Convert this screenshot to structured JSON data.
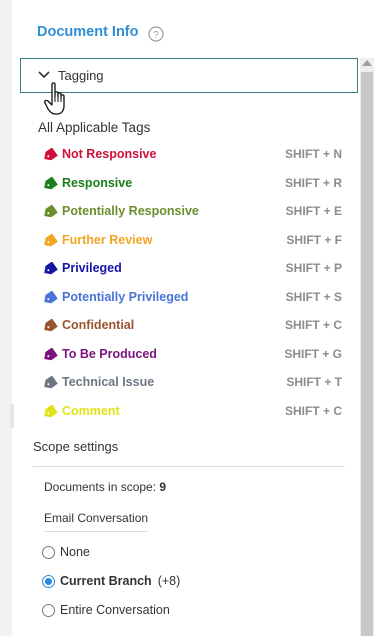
{
  "panel": {
    "title": "Document Info"
  },
  "tagging": {
    "label": "Tagging",
    "section_title": "All Applicable Tags",
    "tags": [
      {
        "name": "Not Responsive",
        "shortcut": "SHIFT + N",
        "color": "#d0103a"
      },
      {
        "name": "Responsive",
        "shortcut": "SHIFT + R",
        "color": "#1a7f1a"
      },
      {
        "name": "Potentially Responsive",
        "shortcut": "SHIFT + E",
        "color": "#6b8f2c"
      },
      {
        "name": "Further Review",
        "shortcut": "SHIFT + F",
        "color": "#f2a423"
      },
      {
        "name": "Privileged",
        "shortcut": "SHIFT + P",
        "color": "#1515a8"
      },
      {
        "name": "Potentially Privileged",
        "shortcut": "SHIFT + S",
        "color": "#4a74d8"
      },
      {
        "name": "Confidential",
        "shortcut": "SHIFT + C",
        "color": "#9a5432"
      },
      {
        "name": "To Be Produced",
        "shortcut": "SHIFT + G",
        "color": "#7a137d"
      },
      {
        "name": "Technical Issue",
        "shortcut": "SHIFT + T",
        "color": "#6e7684"
      },
      {
        "name": "Comment",
        "shortcut": "SHIFT + C",
        "color": "#e2e21a"
      }
    ]
  },
  "scope": {
    "title": "Scope settings",
    "count_label": "Documents in scope:",
    "count_value": "9",
    "conversation_label": "Email Conversation",
    "options": [
      {
        "label": "None",
        "extra": "",
        "selected": false
      },
      {
        "label": "Current Branch",
        "extra": "(+8)",
        "selected": true
      },
      {
        "label": "Entire Conversation",
        "extra": "",
        "selected": false
      }
    ]
  },
  "colors": {
    "accent": "#2e8fd6",
    "radio_accent": "#2a8ce0",
    "tagging_border": "#3c7a82"
  },
  "icons": {
    "help": "help-icon",
    "chevron": "chevron-down-icon",
    "cursor": "hand-cursor-icon",
    "tag": "tag-icon"
  }
}
